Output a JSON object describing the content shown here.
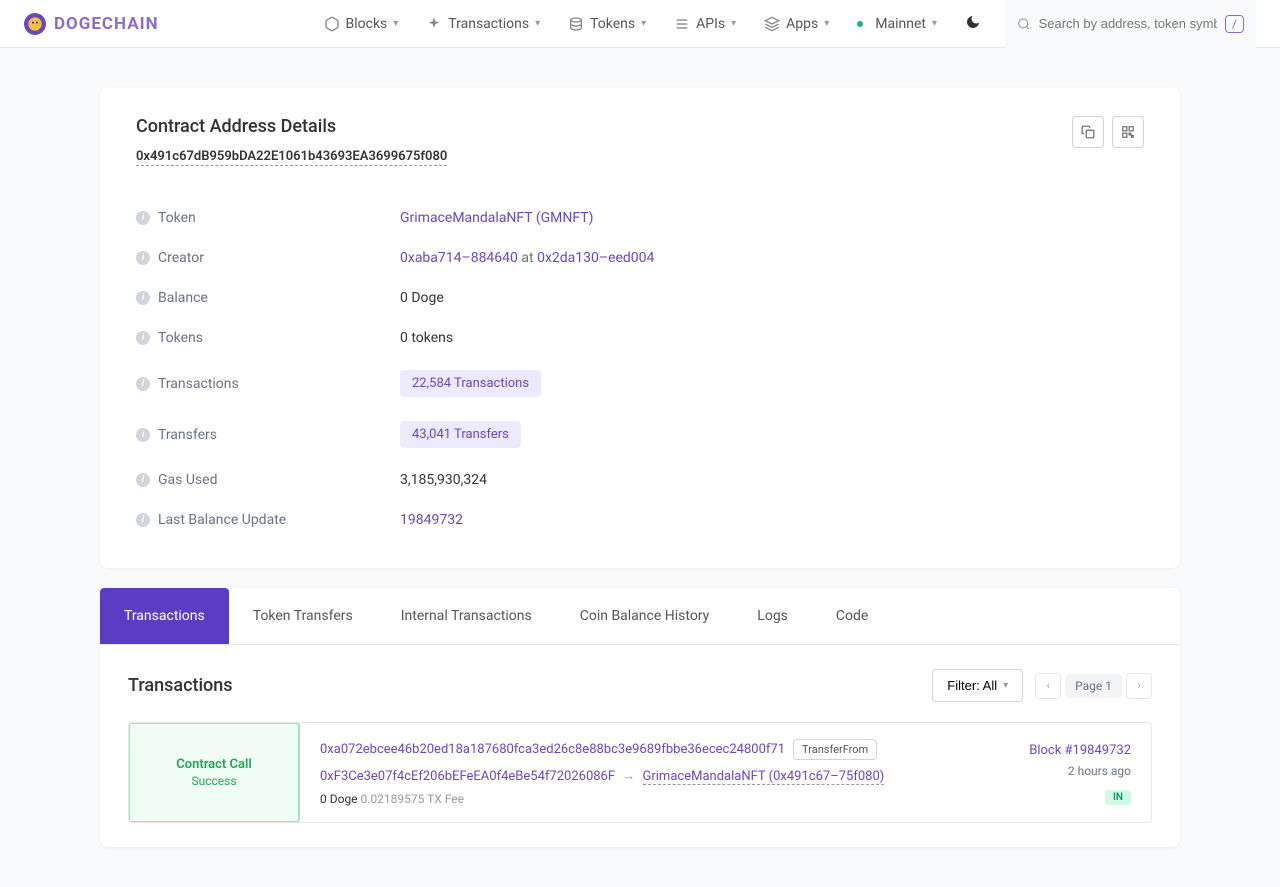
{
  "header": {
    "logo_text": "DOGECHAIN",
    "nav": {
      "blocks": "Blocks",
      "transactions": "Transactions",
      "tokens": "Tokens",
      "apis": "APIs",
      "apps": "Apps",
      "network": "Mainnet"
    },
    "search_placeholder": "Search by address, token symbol, name, transaction",
    "search_kbd": "/"
  },
  "contract": {
    "title": "Contract Address Details",
    "address": "0x491c67dB959bDA22E1061b43693EA3699675f080",
    "fields": {
      "token": {
        "label": "Token",
        "value": "GrimaceMandalaNFT (GMNFT)"
      },
      "creator": {
        "label": "Creator",
        "addr": "0xaba714–884640",
        "at": "at",
        "tx": "0x2da130–eed004"
      },
      "balance": {
        "label": "Balance",
        "value": "0 Doge"
      },
      "tokens": {
        "label": "Tokens",
        "value": "0 tokens"
      },
      "transactions": {
        "label": "Transactions",
        "value": "22,584 Transactions"
      },
      "transfers": {
        "label": "Transfers",
        "value": "43,041 Transfers"
      },
      "gas_used": {
        "label": "Gas Used",
        "value": "3,185,930,324"
      },
      "last_update": {
        "label": "Last Balance Update",
        "value": "19849732"
      }
    }
  },
  "tabs": {
    "transactions": "Transactions",
    "token_transfers": "Token Transfers",
    "internal": "Internal Transactions",
    "coin_history": "Coin Balance History",
    "logs": "Logs",
    "code": "Code"
  },
  "tx_section": {
    "title": "Transactions",
    "filter": "Filter: All",
    "page": "Page 1"
  },
  "tx_row": {
    "type": "Contract Call",
    "status": "Success",
    "hash": "0xa072ebcee46b20ed18a187680fca3ed26c8e88bc3e9689fbbe36ecec24800f71",
    "method": "TransferFrom",
    "from": "0xF3Ce3e07f4cEf206bEFeEA0f4eBe54f72026086F",
    "to": "GrimaceMandalaNFT (0x491c67–75f080)",
    "value": "0 Doge",
    "fee": "0.02189575 TX Fee",
    "block": "Block #19849732",
    "time": "2 hours ago",
    "direction": "IN"
  }
}
